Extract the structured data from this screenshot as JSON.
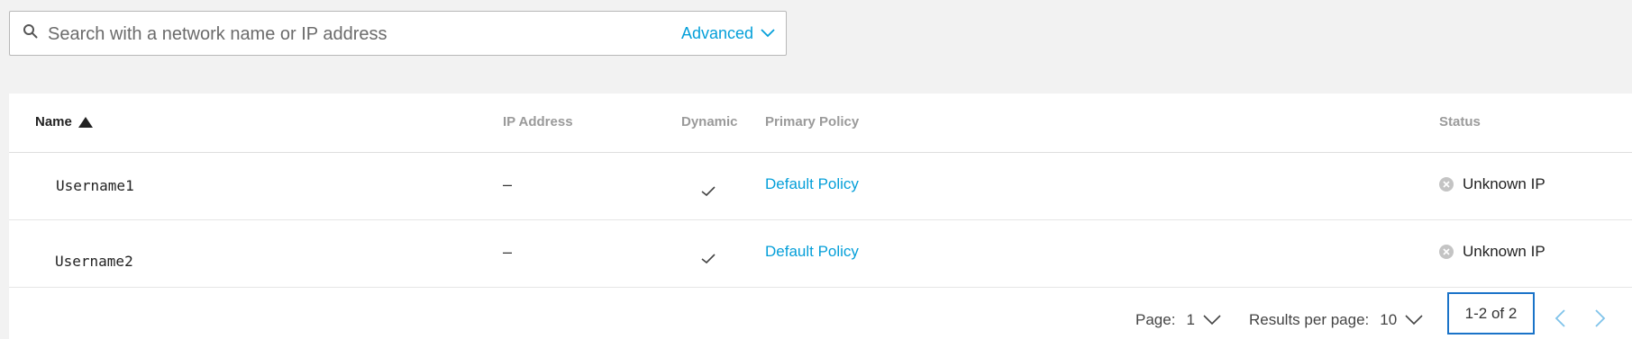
{
  "search": {
    "placeholder": "Search with a network name or IP address",
    "advanced_label": "Advanced"
  },
  "table": {
    "columns": [
      "Name",
      "IP Address",
      "Dynamic",
      "Primary Policy",
      "Status"
    ],
    "sorted_column": "Name",
    "sort_direction": "ascending",
    "rows": [
      {
        "name": "Username1",
        "ip": "–",
        "dynamic": true,
        "policy": "Default Policy",
        "status": "Unknown IP"
      },
      {
        "name": "Username2",
        "ip": "–",
        "dynamic": true,
        "policy": "Default Policy",
        "status": "Unknown IP"
      }
    ]
  },
  "pagination": {
    "page_label": "Page:",
    "page_value": "1",
    "per_page_label": "Results per page:",
    "per_page_value": "10",
    "range": "1-2 of 2"
  },
  "colors": {
    "accent": "#049fd9",
    "focus_border": "#1a73c8",
    "status_icon": "#c4c4c4"
  },
  "icons": {
    "search": "search-icon",
    "advanced_toggle": "chevron-down-icon",
    "sort": "sort-ascending-icon",
    "dynamic_check": "check-icon",
    "status": "close-circle-icon",
    "prev": "chevron-left-icon",
    "next": "chevron-right-icon"
  }
}
